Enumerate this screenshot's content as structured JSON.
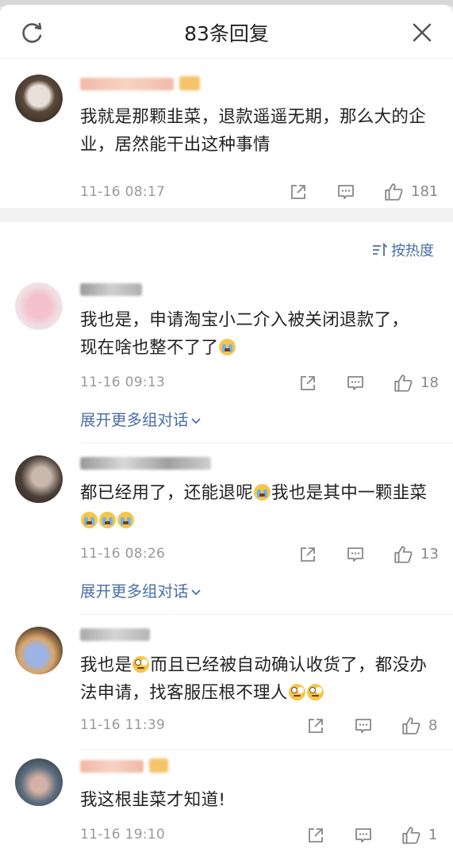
{
  "header": {
    "title": "83条回复"
  },
  "post": {
    "text": "我就是那颗韭菜，退款遥遥无期，那么大的企业，居然能干出这种事情",
    "time": "11-16 08:17",
    "likes": "181"
  },
  "sort_label": "按热度",
  "comments": [
    {
      "text_a": "我也是，申请淘宝小二介入被关闭退款了，现在啥也整不了了",
      "emoji_a": [
        "cry-emoji"
      ],
      "time": "11-16 09:13",
      "likes": "18",
      "expand": "展开更多组对话"
    },
    {
      "text_a": "都已经用了，还能退呢",
      "emoji_a": [
        "cry-emoji"
      ],
      "text_b": "我也是其中一颗韭菜",
      "emoji_b": [
        "cry-emoji",
        "cry-emoji",
        "cry-emoji"
      ],
      "time": "11-16 08:26",
      "likes": "13",
      "expand": "展开更多组对话"
    },
    {
      "text_a": "我也是",
      "emoji_a": [
        "eye-roll-emoji"
      ],
      "text_b": "而且已经被自动确认收货了，都没办法申请，找客服压根不理人",
      "emoji_b": [
        "eye-roll-emoji",
        "eye-roll-emoji"
      ],
      "time": "11-16 11:39",
      "likes": "8"
    },
    {
      "text_a": "我这根韭菜才知道!",
      "time": "11-16 19:10",
      "likes": "1"
    }
  ],
  "icons": {
    "refresh": "refresh-icon",
    "close": "close-icon",
    "share": "share-icon",
    "comment": "comment-icon",
    "like": "like-icon",
    "sort": "sort-icon",
    "expand_chevron": "chevron-down-icon"
  },
  "colors": {
    "link": "#4a6ea9",
    "meta": "#999999",
    "text": "#222222"
  }
}
